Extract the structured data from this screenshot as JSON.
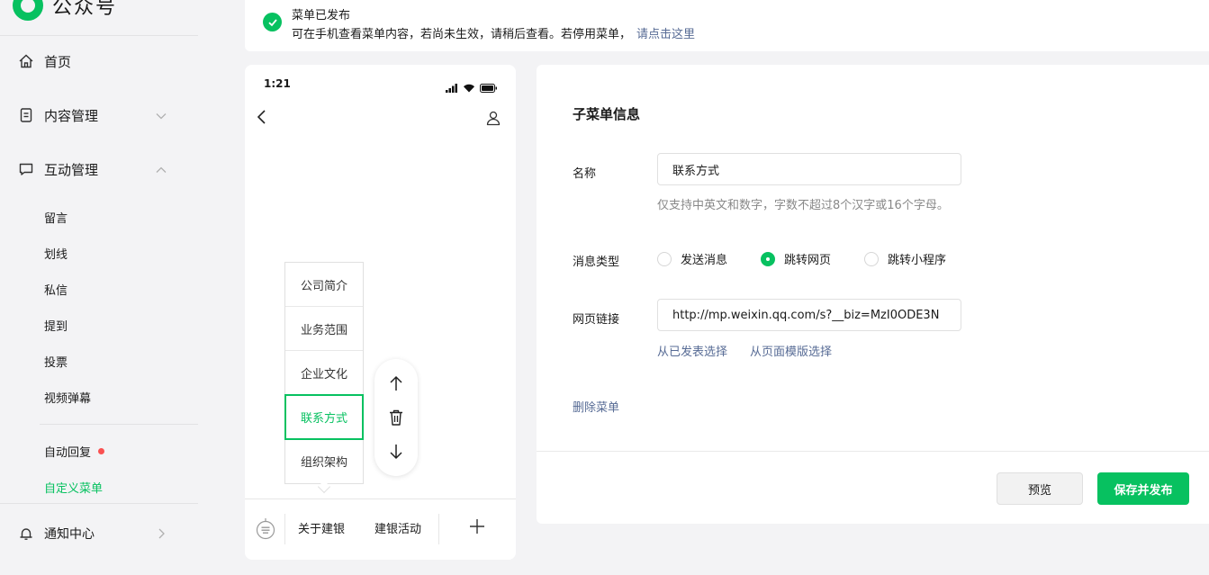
{
  "brand": {
    "name": "公众号"
  },
  "sidebar": {
    "home": "首页",
    "content": "内容管理",
    "interaction": "互动管理",
    "sub": [
      "留言",
      "划线",
      "私信",
      "提到",
      "投票",
      "视频弹幕"
    ],
    "auto_reply": "自动回复",
    "custom_menu": "自定义菜单",
    "notify": "通知中心"
  },
  "toast": {
    "title": "菜单已发布",
    "desc": "可在手机查看菜单内容，若尚未生效，请稍后查看。若停用菜单，",
    "link": "请点击这里"
  },
  "phone": {
    "time": "1:21",
    "submenu": [
      "公司简介",
      "业务范围",
      "企业文化",
      "联系方式",
      "组织架构"
    ],
    "menubar": [
      "关于建银",
      "建银活动"
    ]
  },
  "form": {
    "title": "子菜单信息",
    "name_label": "名称",
    "name_value": "联系方式",
    "name_hint": "仅支持中英文和数字，字数不超过8个汉字或16个字母。",
    "type_label": "消息类型",
    "type_options": [
      "发送消息",
      "跳转网页",
      "跳转小程序"
    ],
    "type_selected": "跳转网页",
    "url_label": "网页链接",
    "url_value": "http://mp.weixin.qq.com/s?__biz=MzI0ODE3N",
    "pick_published": "从已发表选择",
    "pick_template": "从页面模版选择",
    "delete": "删除菜单",
    "preview": "预览",
    "save_publish": "保存并发布"
  },
  "colors": {
    "accent": "#07c160",
    "link": "#576b95",
    "dot": "#fa5151"
  }
}
